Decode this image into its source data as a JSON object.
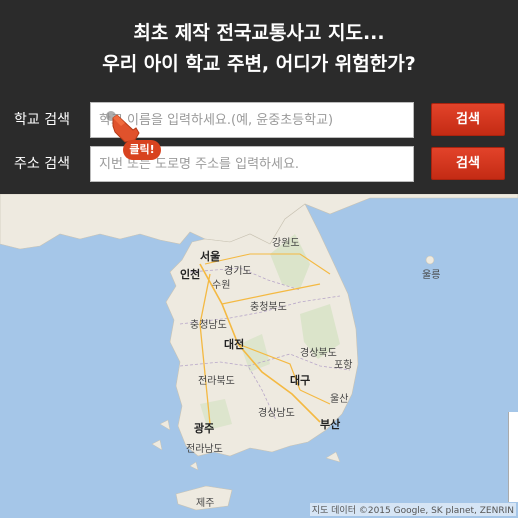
{
  "header": {
    "title_line1": "최초 제작 전국교통사고 지도...",
    "title_line2": "우리 아이 학교 주변, 어디가 위험한가?"
  },
  "school_search": {
    "label": "학교 검색",
    "placeholder": "학교 이름을 입력하세요.(예, 윤중초등학교)",
    "value": "",
    "button": "검색"
  },
  "address_search": {
    "label": "주소 검색",
    "placeholder": "지번 또는 도로명 주소를 입력하세요.",
    "value": "",
    "button": "검색"
  },
  "click_hint": {
    "label": "클릭!",
    "icon": "pointing-hand-icon"
  },
  "map": {
    "labels": {
      "seoul": "서울",
      "incheon": "인천",
      "suwon": "수원",
      "daejeon": "대전",
      "daegu": "대구",
      "gwangju": "광주",
      "busan": "부산",
      "ulsan": "울산",
      "pohang": "포항",
      "gangwon": "강원도",
      "gyeonggi": "경기도",
      "chungbuk": "충청북도",
      "chungnam": "충청남도",
      "gyeongbuk": "경상북도",
      "jeonbuk": "전라북도",
      "jeonnam": "전라남도",
      "gyeongnam": "경상남도",
      "jeju": "제주",
      "ulleung": "울릉"
    },
    "copyright": "지도 데이터 ©2015 Google, SK planet, ZENRIN"
  },
  "colors": {
    "header_bg": "#2b2b2b",
    "button": "#d13418",
    "sea": "#a5c6e8",
    "land": "#eeeae0"
  }
}
